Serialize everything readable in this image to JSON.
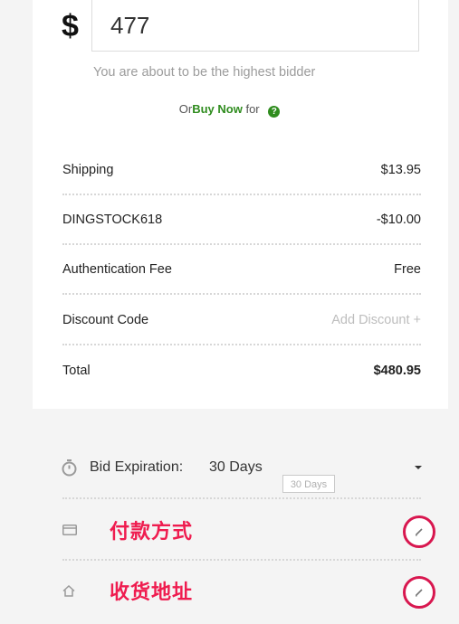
{
  "bid": {
    "currency_symbol": "$",
    "amount": "477",
    "hint": "You are about to be the highest bidder"
  },
  "buy_now": {
    "prefix": "Or",
    "link": "Buy Now",
    "suffix": "for"
  },
  "summary": [
    {
      "label": "Shipping",
      "value": "$13.95"
    },
    {
      "label": "DINGSTOCK618",
      "value": "-$10.00"
    },
    {
      "label": "Authentication Fee",
      "value": "Free"
    },
    {
      "label": "Discount Code",
      "value": "Add Discount +"
    },
    {
      "label": "Total",
      "value": "$480.95"
    }
  ],
  "expiration": {
    "label": "Bid Expiration:",
    "value": "30 Days",
    "tooltip": "30 Days"
  },
  "payment": {
    "label": "付款方式"
  },
  "shipping_address": {
    "label": "收货地址"
  },
  "colors": {
    "accent_green": "#2f8c1e",
    "annotation_red": "#ef1c4f",
    "edit_ring": "#d8174f"
  },
  "icons": [
    "help-icon",
    "timer-icon",
    "caret-down-icon",
    "credit-card-icon",
    "home-icon",
    "pencil-icon"
  ]
}
